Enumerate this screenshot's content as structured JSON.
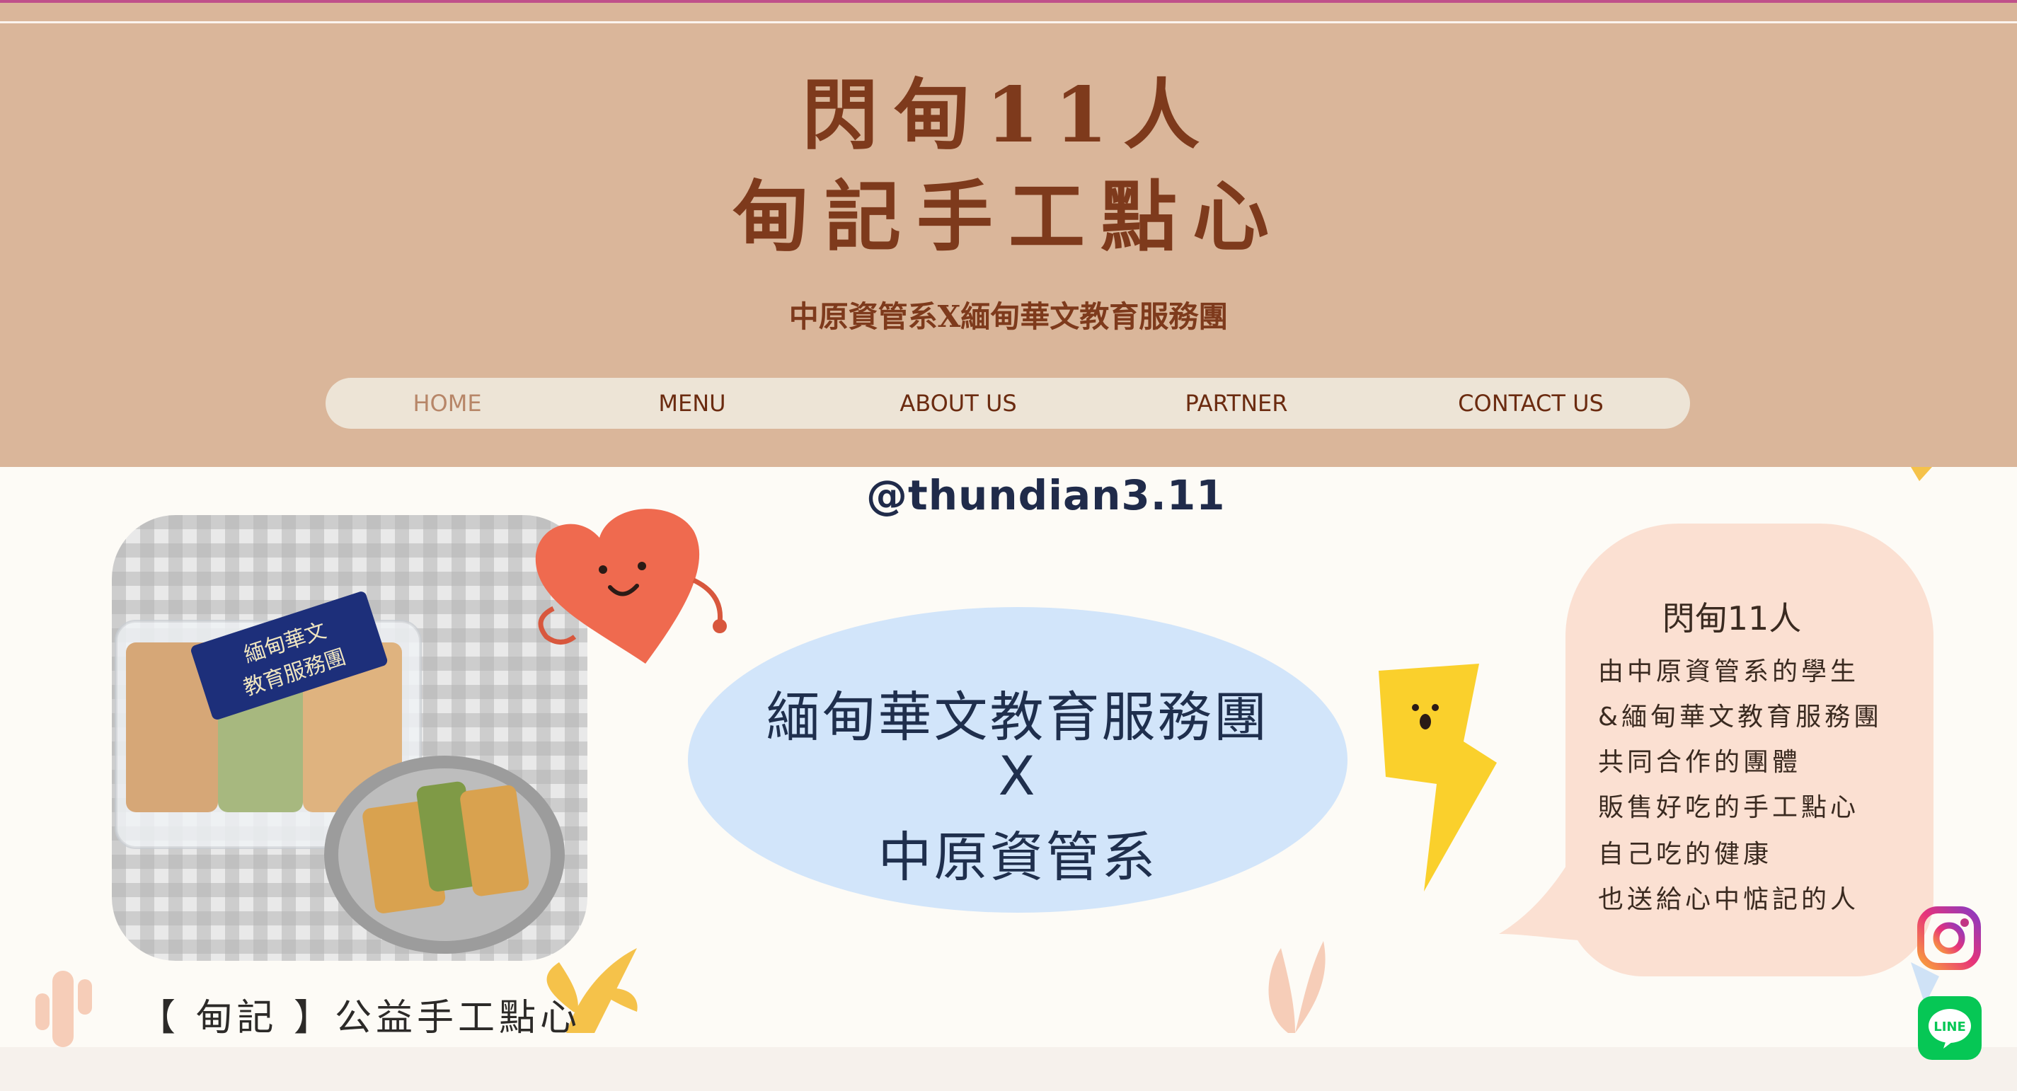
{
  "header": {
    "title_line1": "閃甸11人",
    "title_line2": "甸記手工點心",
    "subtitle": "中原資管系X緬甸華文教育服務團"
  },
  "nav": {
    "items": [
      {
        "label": "HOME",
        "active": true
      },
      {
        "label": "MENU",
        "active": false
      },
      {
        "label": "ABOUT US",
        "active": false
      },
      {
        "label": "PARTNER",
        "active": false
      },
      {
        "label": "CONTACT US",
        "active": false
      }
    ]
  },
  "banner": {
    "handle": "@thundian3.11",
    "box_label_line1": "緬甸華文",
    "box_label_line2": "教育服務團",
    "center_line1": "緬甸華文教育服務團",
    "center_line2": "X",
    "center_line3": "中原資管系",
    "bubble_title": "閃甸11人",
    "bubble_lines": [
      "由中原資管系的學生",
      "&緬甸華文教育服務團",
      "共同合作的團體",
      "販售好吃的手工點心",
      "自己吃的健康",
      "也送給心中惦記的人"
    ],
    "caption": "【 甸記 】公益手工點心"
  },
  "floating": {
    "instagram_icon": "instagram-icon",
    "line_icon": "line-icon",
    "line_label": "LINE"
  },
  "colors": {
    "header_bg": "#dab69a",
    "title": "#7e3a1c",
    "nav_bg": "#ede4d6",
    "nav_active": "#b78668",
    "blob": "#d2e5fa",
    "bubble": "#fbe0d2",
    "line_green": "#06c755"
  }
}
